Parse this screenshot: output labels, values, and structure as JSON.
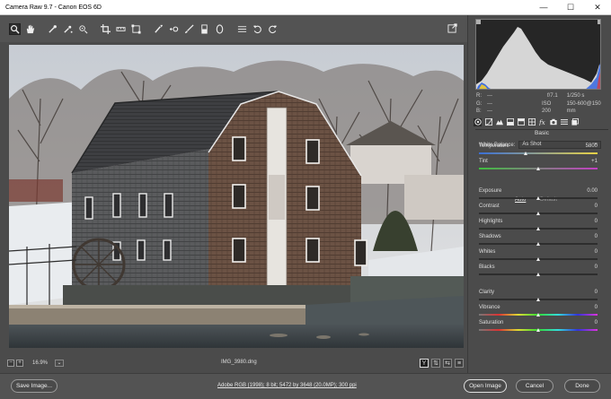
{
  "window": {
    "title": "Camera Raw 9.7  -  Canon EOS 6D",
    "minimize": "—",
    "maximize": "☐",
    "close": "✕"
  },
  "toolbar": {
    "tools": [
      {
        "name": "zoom-tool",
        "icon": "magnifier-icon",
        "active": true
      },
      {
        "name": "hand-tool",
        "icon": "hand-icon"
      },
      {
        "name": "white-balance-tool",
        "icon": "eyedropper-icon"
      },
      {
        "name": "color-sampler-tool",
        "icon": "color-sampler-icon"
      },
      {
        "name": "targeted-adjustment-tool",
        "icon": "target-icon"
      },
      {
        "name": "crop-tool",
        "icon": "crop-icon"
      },
      {
        "name": "straighten-tool",
        "icon": "straighten-icon"
      },
      {
        "name": "transform-tool",
        "icon": "transform-icon"
      },
      {
        "name": "spot-removal-tool",
        "icon": "brush-heal-icon"
      },
      {
        "name": "red-eye-tool",
        "icon": "eye-icon"
      },
      {
        "name": "adjustment-brush-tool",
        "icon": "brush-icon"
      },
      {
        "name": "graduated-filter-tool",
        "icon": "gradient-icon"
      },
      {
        "name": "radial-filter-tool",
        "icon": "ellipse-icon"
      },
      {
        "name": "preferences-tool",
        "icon": "list-icon"
      },
      {
        "name": "rotate-left-tool",
        "icon": "rotate-ccw-icon"
      },
      {
        "name": "rotate-right-tool",
        "icon": "rotate-cw-icon"
      }
    ],
    "right_tool": {
      "name": "fullscreen-toggle",
      "icon": "export-icon"
    }
  },
  "status": {
    "zoom_out": "−",
    "zoom_in": "+",
    "zoom_value": "16.9%",
    "zoom_dropdown": "⌄",
    "filename": "IMG_3980.dng",
    "view_buttons": [
      "Y",
      "⇅",
      "⇆",
      "≡"
    ]
  },
  "bottom": {
    "save_image": "Save Image...",
    "workflow_link": "Adobe RGB (1998); 8 bit; 5472 by 3648 (20.0MP); 300 ppi",
    "open_image": "Open Image",
    "cancel": "Cancel",
    "done": "Done"
  },
  "readout": {
    "r_label": "R:",
    "r_value": "---",
    "g_label": "G:",
    "g_value": "---",
    "b_label": "B:",
    "b_value": "---",
    "aperture": "f/7.1",
    "shutter": "1/250 s",
    "iso": "ISO 200",
    "lens": "150-600@150 mm"
  },
  "panel": {
    "title": "Basic",
    "white_balance_label": "White Balance:",
    "white_balance_value": "As Shot",
    "auto": "Auto",
    "default": "Default",
    "sliders": [
      {
        "label": "Temperature",
        "value": "5800",
        "position": 0.4,
        "gradient": "linear-gradient(90deg,#3a6fd6,#e8d246)"
      },
      {
        "label": "Tint",
        "value": "+1",
        "position": 0.5,
        "gradient": "linear-gradient(90deg,#3fbf3f,#c43fc4)"
      },
      {
        "label": "Exposure",
        "value": "0.00",
        "position": 0.5,
        "gradient": ""
      },
      {
        "label": "Contrast",
        "value": "0",
        "position": 0.5,
        "gradient": ""
      },
      {
        "label": "Highlights",
        "value": "0",
        "position": 0.5,
        "gradient": ""
      },
      {
        "label": "Shadows",
        "value": "0",
        "position": 0.5,
        "gradient": ""
      },
      {
        "label": "Whites",
        "value": "0",
        "position": 0.5,
        "gradient": ""
      },
      {
        "label": "Blacks",
        "value": "0",
        "position": 0.5,
        "gradient": ""
      },
      {
        "label": "Clarity",
        "value": "0",
        "position": 0.5,
        "gradient": ""
      },
      {
        "label": "Vibrance",
        "value": "0",
        "position": 0.5,
        "gradient": "linear-gradient(90deg,#777,#d33,#dd3,#3d3,#3dd,#33d,#d3d)"
      },
      {
        "label": "Saturation",
        "value": "0",
        "position": 0.5,
        "gradient": "linear-gradient(90deg,#777,#d33,#dd3,#3d3,#3dd,#33d,#d3d)"
      }
    ],
    "tabs": [
      {
        "name": "basic",
        "icon": "aperture-icon",
        "selected": true
      },
      {
        "name": "tone-curve",
        "icon": "curve-icon"
      },
      {
        "name": "detail",
        "icon": "mountain-icon"
      },
      {
        "name": "hsl",
        "icon": "hsl-icon"
      },
      {
        "name": "split-toning",
        "icon": "split-icon"
      },
      {
        "name": "lens-corrections",
        "icon": "lens-icon"
      },
      {
        "name": "effects",
        "icon": "fx-icon"
      },
      {
        "name": "camera-calibration",
        "icon": "camera-icon"
      },
      {
        "name": "presets",
        "icon": "presets-icon"
      },
      {
        "name": "snapshots",
        "icon": "snapshot-icon"
      }
    ]
  },
  "colors": {
    "accent_border": "#ffffff",
    "panel_bg": "#4b4b4b",
    "toolbar_bg": "#535353"
  }
}
